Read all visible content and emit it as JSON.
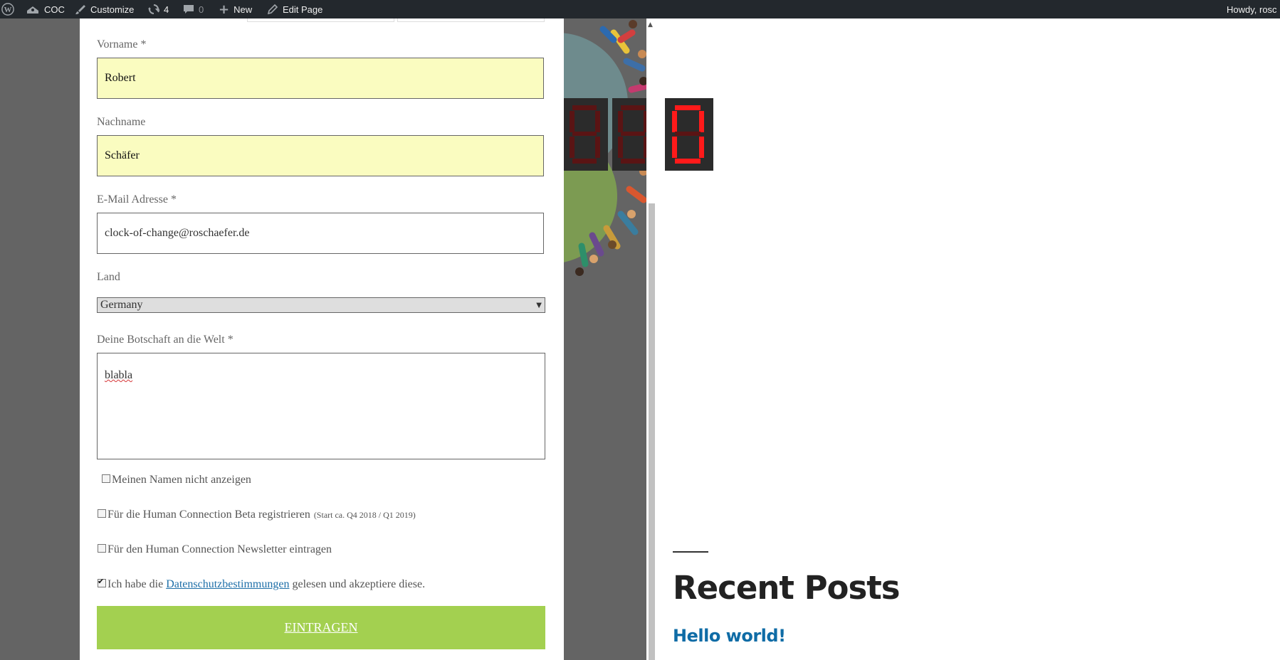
{
  "admin_bar": {
    "site_name": "COC",
    "customize": "Customize",
    "updates_count": "4",
    "comments_count": "0",
    "new": "New",
    "edit_page": "Edit Page",
    "howdy": "Howdy, rosc"
  },
  "form": {
    "first_name": {
      "label": "Vorname *",
      "value": "Robert"
    },
    "last_name": {
      "label": "Nachname",
      "value": "Schäfer"
    },
    "email": {
      "label": "E-Mail Adresse *",
      "value": "clock-of-change@roschaefer.de"
    },
    "country": {
      "label": "Land",
      "selected": "Germany"
    },
    "message": {
      "label": "Deine Botschaft an die Welt *",
      "value": "blabla"
    },
    "checkboxes": [
      {
        "label": "Meinen Namen nicht anzeigen",
        "checked": false
      },
      {
        "label": "Für die Human Connection Beta registrieren",
        "note": "(Start ca. Q4 2018 / Q1 2019)",
        "checked": false
      },
      {
        "label": "Für den Human Connection Newsletter eintragen",
        "checked": false
      },
      {
        "label_before": "Ich habe die",
        "link": "Datenschutzbestimmungen",
        "label_after": "gelesen und akzeptiere diese.",
        "checked": true
      }
    ],
    "submit": "EINTRAGEN"
  },
  "sidebar": {
    "widget_title": "Recent Posts",
    "posts": [
      "Hello world!"
    ]
  },
  "colors": {
    "admin_bar": "#23282d",
    "overlay": "#646464",
    "filled_input": "#fafcc0",
    "submit": "#a3d050",
    "link": "#0f6ca6",
    "segment_red": "#ff0000"
  }
}
